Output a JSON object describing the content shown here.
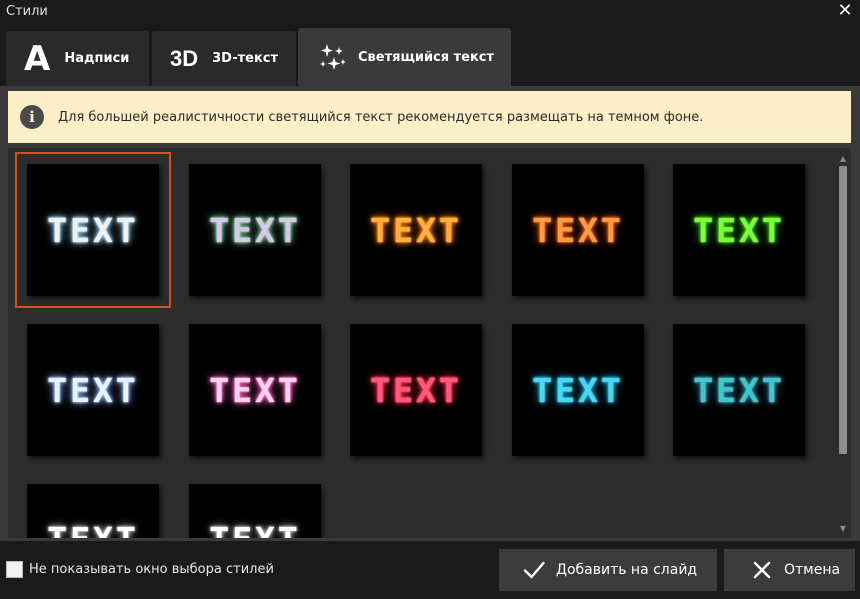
{
  "window": {
    "title": "Стили"
  },
  "tabs": [
    {
      "icon_text": "A",
      "label": "Надписи"
    },
    {
      "icon_text": "3D",
      "label": "3D-текст"
    },
    {
      "label": "Светящийся текст"
    }
  ],
  "notice": {
    "icon_text": "i",
    "text": "Для большей реалистичности светящийся текст рекомендуется размещать на темном фоне."
  },
  "styles": [
    {
      "text": "TEXT",
      "color": "#f0f0f0",
      "glow": "#9fd8ff"
    },
    {
      "text": "TEXT",
      "color": "#d8c8e8",
      "glow": "#7fd0a0"
    },
    {
      "text": "TEXT",
      "color": "#ffb040",
      "glow": "#ff7a00"
    },
    {
      "text": "TEXT",
      "color": "#ff9a40",
      "glow": "#d84a00"
    },
    {
      "text": "TEXT",
      "color": "#7aff3a",
      "glow": "#30c000"
    },
    {
      "text": "TEXT",
      "color": "#e8f2ff",
      "glow": "#8ab8ff"
    },
    {
      "text": "TEXT",
      "color": "#ffd0f0",
      "glow": "#ff60c0"
    },
    {
      "text": "TEXT",
      "color": "#ff5a7a",
      "glow": "#ff2040"
    },
    {
      "text": "TEXT",
      "color": "#4ad8f0",
      "glow": "#0aa0d0"
    },
    {
      "text": "TEXT",
      "color": "#40c8c8",
      "glow": "#2080a0"
    },
    {
      "text": "TEXT",
      "color": "#ffffff",
      "glow": "#aaaaaa"
    },
    {
      "text": "TEXT",
      "color": "#ffffff",
      "glow": "#aaaaaa"
    }
  ],
  "selected_index": 0,
  "footer": {
    "checkbox_label": "Не показывать окно выбора стилей",
    "add_label": "Добавить на слайд",
    "cancel_label": "Отмена"
  },
  "colors": {
    "accent": "#d0531f",
    "notice_bg": "#fdf0c8",
    "panel_bg": "#3a3a3a",
    "window_bg": "#1a1a1a"
  }
}
